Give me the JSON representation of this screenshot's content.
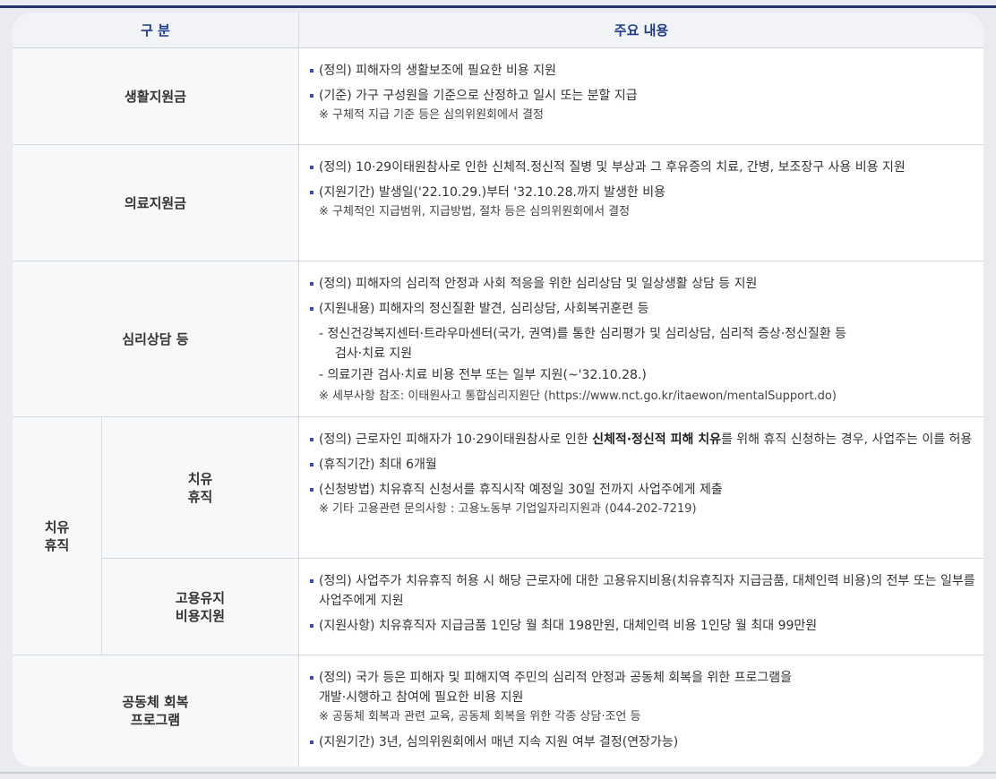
{
  "header": {
    "col1": "구 분",
    "col2": "주요 내용"
  },
  "rows": [
    {
      "label": "생활지원금",
      "lines": [
        "(정의) 피해자의 생활보조에 필요한 비용 지원",
        "(기준) 가구 구성원을 기준으로 산정하고 일시 또는 분할 지급",
        "※ 구체적 지급 기준 등은 심의위원회에서 결정"
      ]
    },
    {
      "label": "의료지원금",
      "lines": [
        "(정의) 10·29이태원참사로 인한 신체적.정신적 질병 및 부상과 그 후유증의 치료, 간병, 보조장구 사용 비용 지원",
        "(지원기간) 발생일('22.10.29.)부터 '32.10.28.까지 발생한 비용",
        "※ 구체적인 지급범위, 지급방법, 절차 등은 심의위원회에서 결정"
      ]
    },
    {
      "label": "심리상담 등",
      "lines": [
        "(정의) 피해자의 심리적 안정과 사회 적응을 위한 심리상담 및 일상생활 상담 등 지원",
        "(지원내용) 피해자의 정신질환 발견, 심리상담, 사회복귀훈련 등",
        "- 정신건강복지센터·트라우마센터(국가, 권역)를 통한 심리평가 및 심리상담, 심리적 증상·정신질환 등",
        "검사·치료 지원",
        "- 의료기관 검사·치료 비용 전부 또는 일부 지원(~'32.10.28.)",
        "※ 세부사항 참조: 이태원사고 통합심리지원단 (https://www.nct.go.kr/itaewon/mentalSupport.do)"
      ]
    },
    {
      "group": [
        "치유",
        "휴직"
      ],
      "label": [
        "치유",
        "휴직"
      ],
      "lines": [
        "(정의) 근로자인 피해자가 10·29이태원참사로 인한 ",
        "신체적·정신적 피해 치유",
        "를 위해 휴직 신청하는 경우, 사업주는 이를 허용",
        "(휴직기간) 최대 6개월",
        "(신청방법) 치유휴직 신청서를 휴직시작 예정일 30일 전까지 사업주에게 제출",
        "※ 기타 고용관련 문의사항 : 고용노동부 기업일자리지원과 (044-202-7219)"
      ]
    },
    {
      "label": [
        "고용유지",
        "비용지원"
      ],
      "lines": [
        "(정의) 사업주가 치유휴직 허용 시 해당 근로자에 대한 고용유지비용(치유휴직자 지급금품, 대체인력 비용)의 전부 또는 일부를 사업주에게 지원",
        "(지원사항) 치유휴직자 지급금품 1인당 월 최대 198만원, 대체인력 비용 1인당 월 최대 99만원"
      ]
    },
    {
      "label": [
        "공동체 회복",
        "프로그램"
      ],
      "lines": [
        "(정의) 국가 등은 피해자 및 피해지역 주민의 심리적 안정과 공동체 회복을 위한 프로그램을",
        "개발·시행하고 참여에 필요한 비용 지원",
        "※ 공동체 회복과 관련 교육, 공동체 회복을 위한 각종 상담·조언 등",
        "(지원기간) 3년, 심의위원회에서 매년 지속 지원 여부 결정(연장가능)"
      ]
    }
  ]
}
